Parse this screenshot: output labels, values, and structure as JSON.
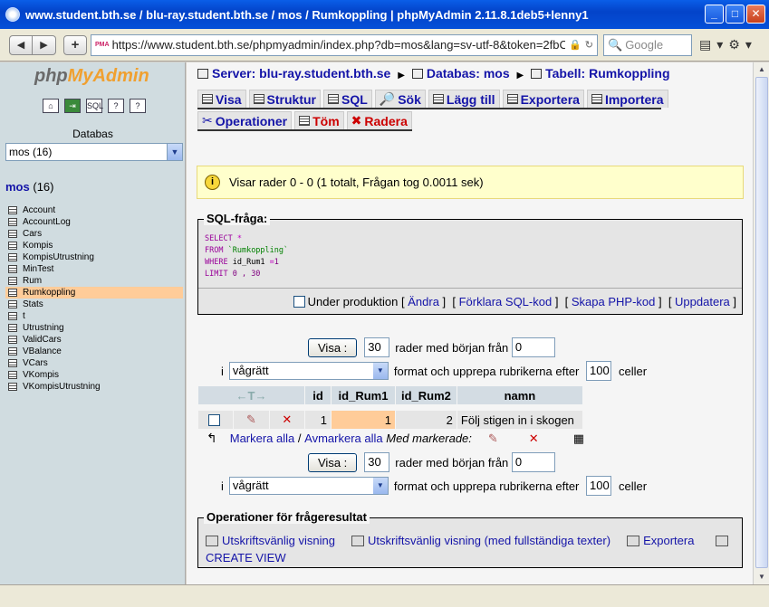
{
  "window": {
    "title": "www.student.bth.se / blu-ray.student.bth.se / mos / Rumkoppling | phpMyAdmin 2.11.8.1deb5+lenny1"
  },
  "browser": {
    "url": "https://www.student.bth.se/phpmyadmin/index.php?db=mos&lang=sv-utf-8&token=2fbC",
    "search_placeholder": "Google"
  },
  "sidebar": {
    "logo_php": "php",
    "logo_my": "MyAdmin",
    "databases_label": "Databas",
    "selected_db": "mos (16)",
    "db_name": "mos",
    "db_count": "(16)",
    "tables": [
      "Account",
      "AccountLog",
      "Cars",
      "Kompis",
      "KompisUtrustning",
      "MinTest",
      "Rum",
      "Rumkoppling",
      "Stats",
      "t",
      "Utrustning",
      "ValidCars",
      "VBalance",
      "VCars",
      "VKompis",
      "VKompisUtrustning"
    ],
    "active_table": "Rumkoppling"
  },
  "breadcrumb": {
    "server": "Server: blu-ray.student.bth.se",
    "database": "Databas: mos",
    "table": "Tabell: Rumkoppling"
  },
  "tabs": {
    "visa": "Visa",
    "struktur": "Struktur",
    "sql": "SQL",
    "sok": "Sök",
    "lagg_till": "Lägg till",
    "exportera": "Exportera",
    "importera": "Importera",
    "operationer": "Operationer",
    "tom": "Töm",
    "radera": "Radera"
  },
  "notice": "Visar rader 0 - 0 (1 totalt, Frågan tog 0.0011 sek)",
  "sql": {
    "legend": "SQL-fråga:",
    "line1_kw": "SELECT",
    "line1_rest": " *",
    "line2_kw": "FROM",
    "line2_rest": " `Rumkoppling`",
    "line3_kw": "WHERE",
    "line3_col": " id_Rum1 ",
    "line3_op": "=",
    "line3_val": "1",
    "line4_kw": "LIMIT",
    "line4_rest": "0 , 30",
    "under_produktion": "Under produktion",
    "andra": "Ändra",
    "forklara": "Förklara SQL-kod",
    "skapa_php": "Skapa PHP-kod",
    "uppdatera": "Uppdatera"
  },
  "nav": {
    "visa_btn": "Visa :",
    "rows": "30",
    "rows_label": "rader med början från",
    "start": "0",
    "i_label": "i",
    "mode": "vågrätt",
    "format_label": "format och upprepa rubrikerna efter",
    "repeat": "100",
    "celler": "celler"
  },
  "table": {
    "sort_arrows": "←T→",
    "headers": [
      "id",
      "id_Rum1",
      "id_Rum2",
      "namn"
    ],
    "row": {
      "id": "1",
      "id_Rum1": "1",
      "id_Rum2": "2",
      "namn": "Följ stigen in i skogen"
    }
  },
  "bulk": {
    "markera_alla": "Markera alla",
    "slash": "/",
    "avmarkera_alla": "Avmarkera alla",
    "med_markerade": "Med markerade:"
  },
  "operations": {
    "legend": "Operationer för frågeresultat",
    "print_view": "Utskriftsvänlig visning",
    "print_view_full": "Utskriftsvänlig visning (med fullständiga texter)",
    "exportera": "Exportera",
    "create_view": "CREATE VIEW"
  }
}
